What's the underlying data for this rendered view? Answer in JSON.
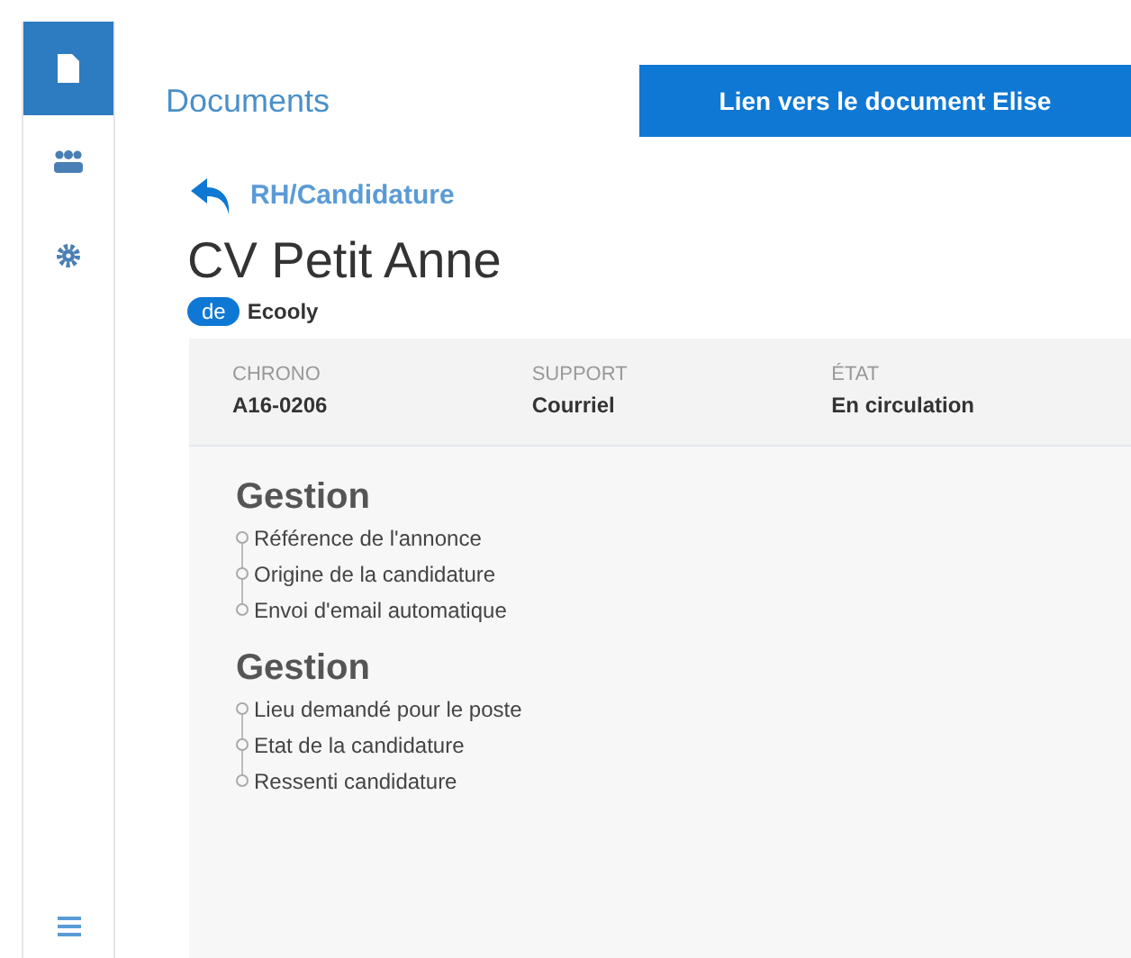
{
  "sidebar": {
    "items": [
      {
        "kind": "document",
        "selected": true
      },
      {
        "kind": "people",
        "selected": false
      },
      {
        "kind": "gear",
        "selected": false
      }
    ]
  },
  "header": {
    "title": "Documents",
    "button": "Lien vers le document Elise"
  },
  "breadcrumb": "RH/Candidature",
  "document": {
    "title": "CV Petit Anne",
    "badge": "de",
    "owner": "Ecooly"
  },
  "fields": [
    {
      "label": "CHRONO",
      "value": "A16-0206"
    },
    {
      "label": "SUPPORT",
      "value": "Courriel"
    },
    {
      "label": "ÉTAT",
      "value": "En circulation"
    }
  ],
  "sections": [
    {
      "title": "Gestion",
      "items": [
        "Référence de l'annonce",
        "Origine de la candidature",
        "Envoi d'email automatique"
      ]
    },
    {
      "title": "Gestion",
      "items": [
        "Lieu demandé pour le poste",
        "Etat de la candidature",
        "Ressenti candidature"
      ]
    }
  ]
}
